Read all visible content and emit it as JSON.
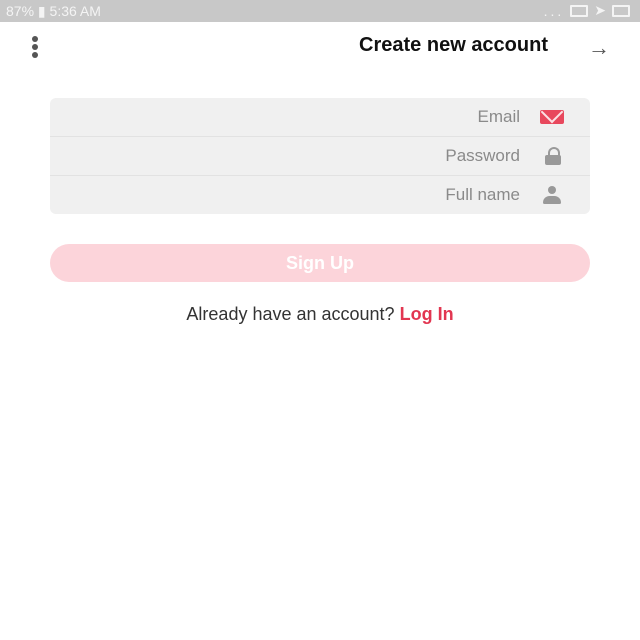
{
  "status_bar": {
    "time": "5:36 AM",
    "battery": "87%",
    "overflow": "...",
    "icons": [
      "location-icon",
      "bluetooth-icon",
      "wifi-icon",
      "signal-icon",
      "battery-icon",
      "overflow-dots-icon",
      "notification-box-icon",
      "send-icon",
      "image-icon"
    ]
  },
  "header": {
    "title": "Create new account",
    "back_icon": "arrow-icon",
    "menu_icon": "more-vert-icon"
  },
  "form": {
    "email_placeholder": "Email",
    "password_placeholder": "Password",
    "fullname_placeholder": "Full name"
  },
  "signup": {
    "label": "Sign Up"
  },
  "login_prompt": {
    "text": "Already have an account?",
    "link": "Log In"
  },
  "colors": {
    "accent": "#e23651",
    "signup_bg": "#fcd4da",
    "field_bg": "#f0f0f0",
    "statusbar_bg": "#c8c8c8"
  }
}
